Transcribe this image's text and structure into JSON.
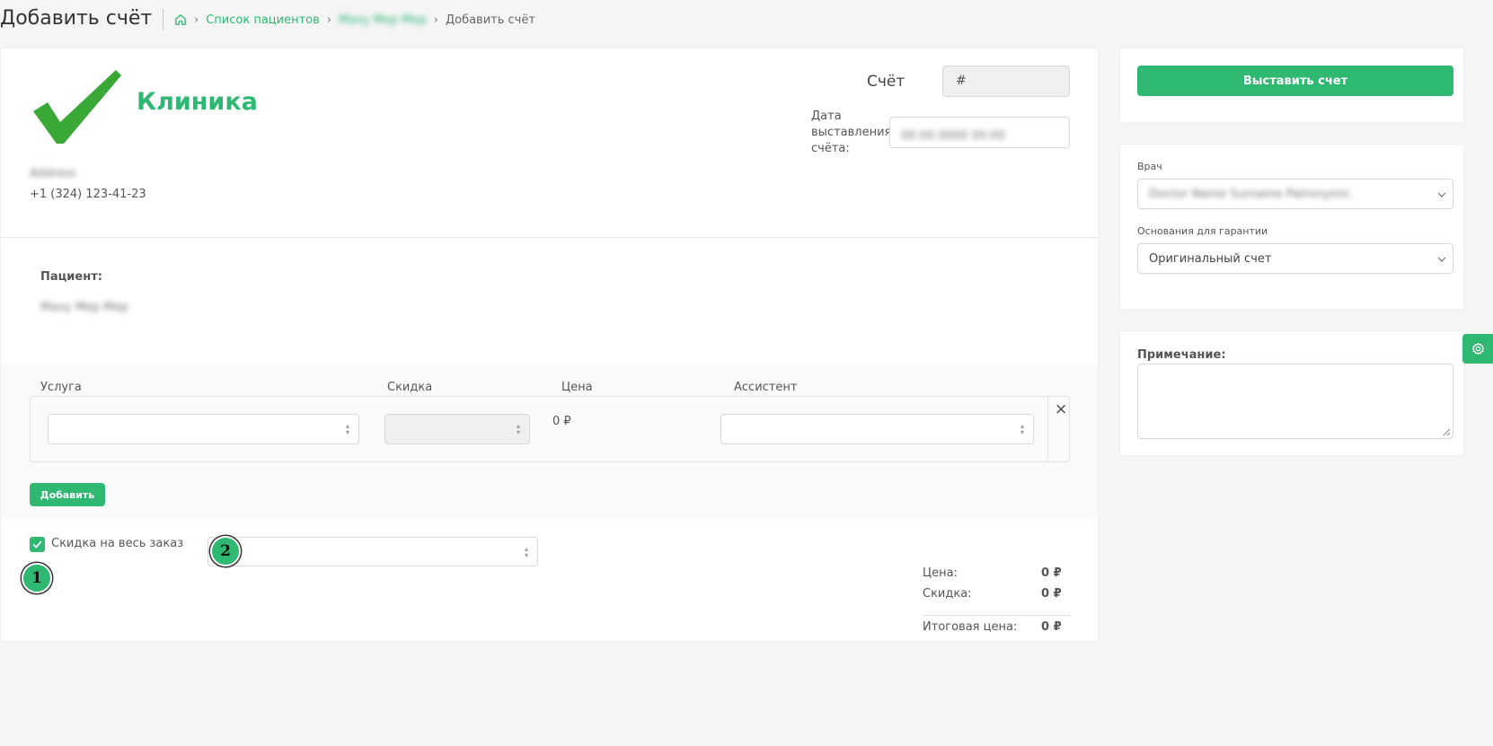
{
  "page": {
    "title": "Добавить счёт"
  },
  "breadcrumb": {
    "items": [
      {
        "label": "Список пациентов"
      },
      {
        "label": "Maxy Mep Mep"
      },
      {
        "label": "Добавить счёт"
      }
    ]
  },
  "clinic": {
    "name": "Клиника",
    "address": "Address",
    "phone": "+1 (324) 123-41-23"
  },
  "invoice": {
    "number_label": "Счёт",
    "number_placeholder": "#",
    "date_label_line1": "Дата",
    "date_label_line2": "выставления",
    "date_label_line3": "счёта:",
    "date_value": "00.00.0000 00:00"
  },
  "patient": {
    "label": "Пациент:",
    "name": "Maxy Mep Mep"
  },
  "services": {
    "headers": {
      "service": "Услуга",
      "discount": "Скидка",
      "price": "Цена",
      "assistant": "Ассистент"
    },
    "rows": [
      {
        "price": "0 ₽"
      }
    ],
    "add_label": "Добавить"
  },
  "order_discount": {
    "label": "Скидка на весь заказ",
    "checked": true
  },
  "totals": {
    "price_label": "Цена:",
    "price_value": "0 ₽",
    "discount_label": "Скидка:",
    "discount_value": "0 ₽",
    "total_label": "Итоговая цена:",
    "total_value": "0 ₽"
  },
  "sidebar": {
    "submit_label": "Выставить счет",
    "doctor_label": "Врач",
    "doctor_value": "Doctor Name Surname Patronymic",
    "guarantee_label": "Основания для гарантии",
    "guarantee_value": "Оригинальный счет",
    "note_label": "Примечание:"
  },
  "markers": [
    {
      "label": "1"
    },
    {
      "label": "2"
    }
  ],
  "colors": {
    "accent": "#2eb872",
    "background": "#f5f5f5"
  }
}
